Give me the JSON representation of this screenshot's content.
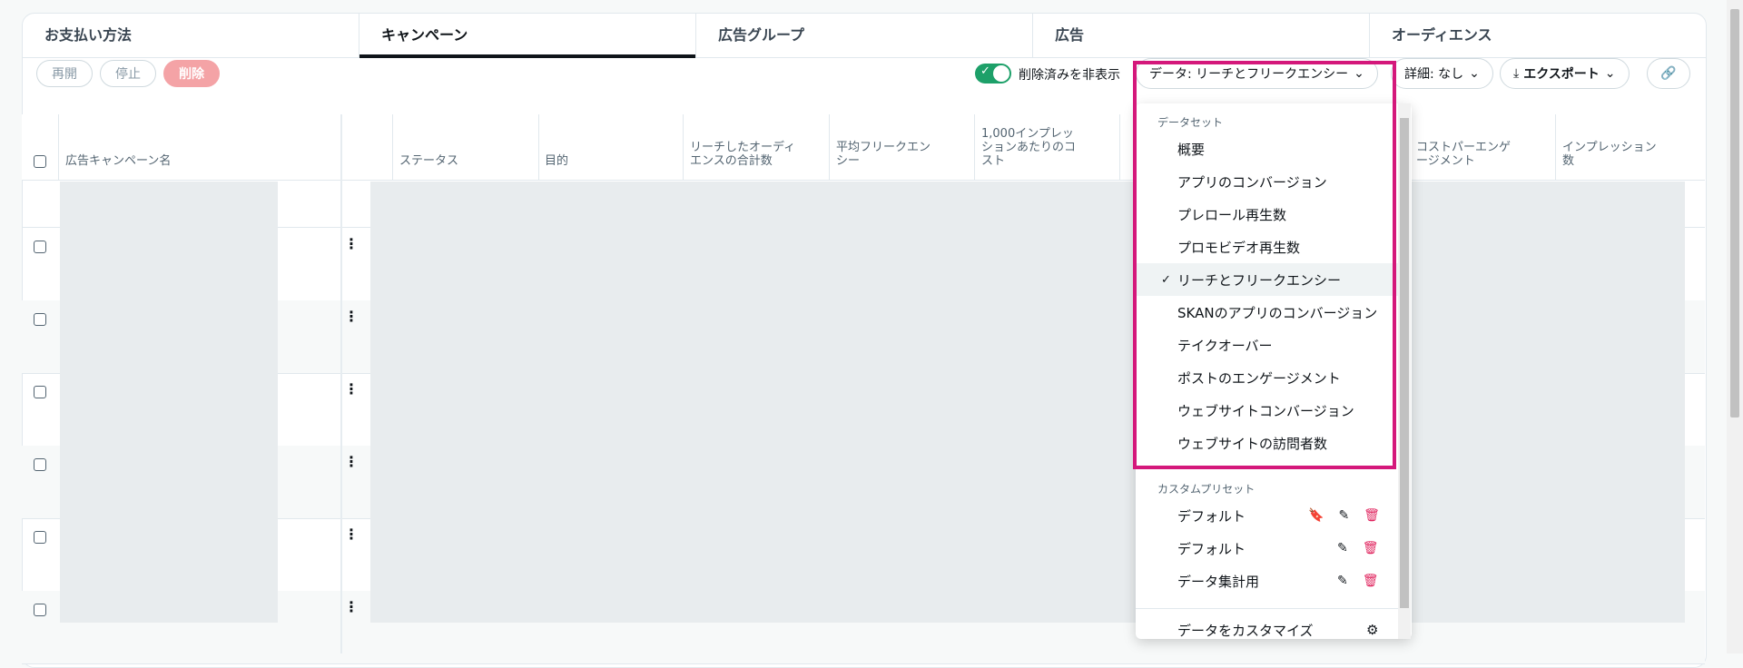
{
  "tabs": [
    "お支払い方法",
    "キャンペーン",
    "広告グループ",
    "広告",
    "オーディエンス"
  ],
  "actions": {
    "resume": "再開",
    "pause": "停止",
    "delete": "削除"
  },
  "toggle_label": "削除済みを非表示",
  "data_button": {
    "label": "データ: リーチとフリークエンシー"
  },
  "details_button": {
    "label": "詳細: なし"
  },
  "export_button": {
    "label": "エクスポート"
  },
  "columns": {
    "campaign_name": "広告キャンペーン名",
    "status": "ステータス",
    "objective": "目的",
    "reach_total": "リーチしたオーディエンスの合計数",
    "avg_frequency": "平均フリークエンシー",
    "cost_per_1000": "1,000インプレッションあたりのコスト",
    "cost_per_engagement": "コストパーエンゲージメント",
    "impressions": "インプレッション数"
  },
  "row_dash": "-",
  "dropdown": {
    "dataset_title": "データセット",
    "datasets": [
      "概要",
      "アプリのコンバージョン",
      "プレロール再生数",
      "プロモビデオ再生数",
      "リーチとフリークエンシー",
      "SKANのアプリのコンバージョン",
      "テイクオーバー",
      "ポストのエンゲージメント",
      "ウェブサイトコンバージョン",
      "ウェブサイトの訪問者数"
    ],
    "selected_dataset": "リーチとフリークエンシー",
    "custom_title": "カスタムプリセット",
    "presets": [
      "デフォルト",
      "デフォルト",
      "データ集計用"
    ],
    "customize": "データをカスタマイズ"
  },
  "colors": {
    "toggle": "#1da069",
    "highlight": "#d4187b",
    "delete": "#f4a3a6"
  }
}
